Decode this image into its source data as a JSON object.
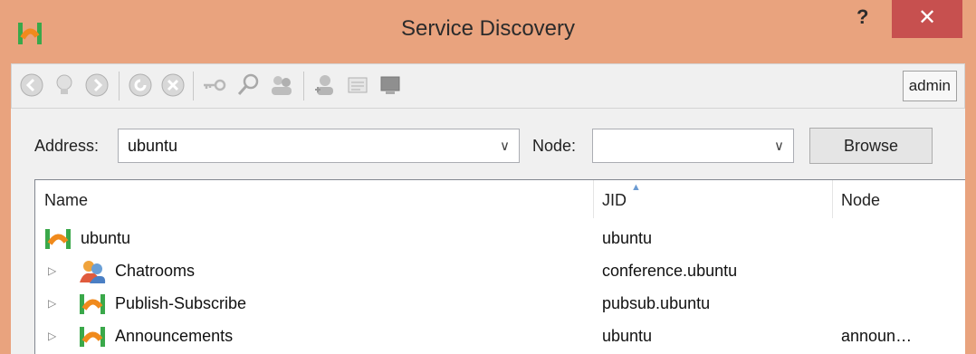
{
  "window": {
    "title": "Service Discovery",
    "help_label": "?",
    "close_label": "✕"
  },
  "toolbar": {
    "buttons": [
      "back-icon",
      "bulb-icon",
      "forward-icon",
      "refresh-icon",
      "stop-icon",
      "key-icon",
      "search-user-icon",
      "users-icon",
      "add-user-icon",
      "info-icon",
      "console-icon"
    ],
    "user_label": "admin"
  },
  "address": {
    "label": "Address:",
    "value": "ubuntu"
  },
  "node": {
    "label": "Node:",
    "value": ""
  },
  "browse_label": "Browse",
  "list": {
    "columns": [
      "Name",
      "JID",
      "Node"
    ],
    "rows": [
      {
        "name": "ubuntu",
        "jid": "ubuntu",
        "node": "",
        "icon": "server-icon",
        "expander": false
      },
      {
        "name": "Chatrooms",
        "jid": "conference.ubuntu",
        "node": "",
        "icon": "chatrooms-icon",
        "expander": true
      },
      {
        "name": "Publish-Subscribe",
        "jid": "pubsub.ubuntu",
        "node": "",
        "icon": "server-icon",
        "expander": true
      },
      {
        "name": "Announcements",
        "jid": "ubuntu",
        "node": "announ…",
        "icon": "server-icon",
        "expander": true
      }
    ]
  },
  "colors": {
    "title_bar": "#e9a37e",
    "close": "#c7504f",
    "panel": "#f0f0f0"
  }
}
